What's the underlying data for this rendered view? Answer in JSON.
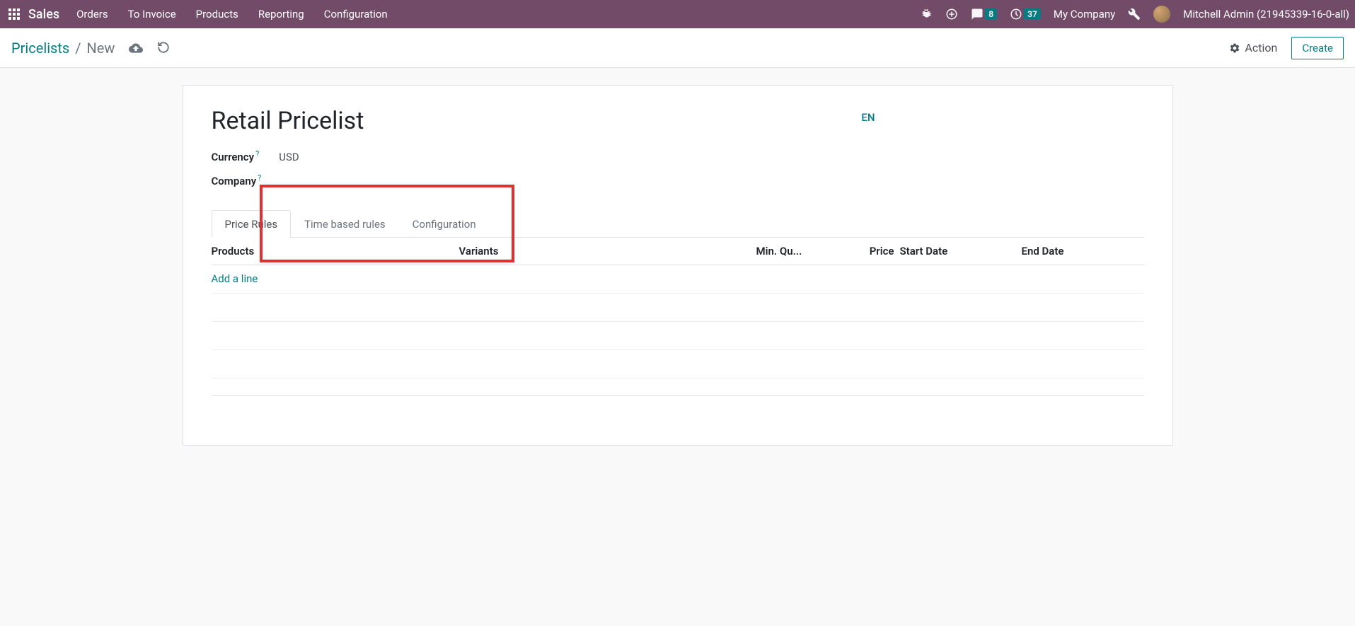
{
  "topnav": {
    "brand": "Sales",
    "menu": [
      "Orders",
      "To Invoice",
      "Products",
      "Reporting",
      "Configuration"
    ],
    "messages_badge": "8",
    "activities_badge": "37",
    "company": "My Company",
    "user": "Mitchell Admin (21945339-16-0-all)"
  },
  "breadcrumb": {
    "parent": "Pricelists",
    "current": "New"
  },
  "actions": {
    "action_label": "Action",
    "create_label": "Create"
  },
  "form": {
    "title": "Retail Pricelist",
    "currency_label": "Currency",
    "currency_value": "USD",
    "company_label": "Company",
    "company_value": "",
    "lang": "EN"
  },
  "tabs": [
    "Price Rules",
    "Time based rules",
    "Configuration"
  ],
  "grid": {
    "headers": {
      "products": "Products",
      "variants": "Variants",
      "minqu": "Min. Qu...",
      "price": "Price",
      "startdate": "Start Date",
      "enddate": "End Date"
    },
    "add_line": "Add a line"
  }
}
